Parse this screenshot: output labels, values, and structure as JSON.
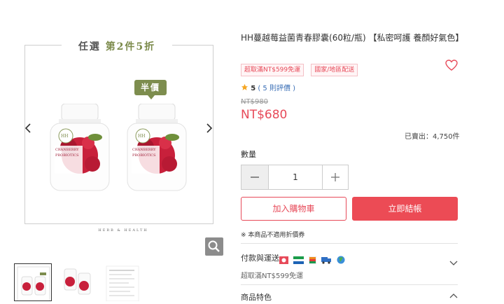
{
  "product": {
    "title": "HH蔓越莓益菌青春膠囊(60粒/瓶) 【私密呵護 養顏好氣色】",
    "tags": [
      "超取滿NT$599免運",
      "國家/地區配送"
    ],
    "rating": "5",
    "review_link": "( 5 則評價 )",
    "original_price": "NT$980",
    "price": "NT$680",
    "sold": "已賣出：4,750件",
    "quantity_label": "數量",
    "quantity": "1",
    "add_to_cart": "加入購物車",
    "buy_now": "立即結帳",
    "coupon_note": "※ 本商品不適用折價券",
    "accent_color": "#e74a59"
  },
  "gallery": {
    "promo_text_1": "任選",
    "promo_text_2": "第2件5折",
    "half_price_badge": "半價",
    "bottle_label_1": "CRANBERRY",
    "bottle_label_2": "PROBIOTICS",
    "bottle_logo": "HH",
    "brand_footer": "HERB & HEALTH",
    "thumbnail_count": 3
  },
  "sections": {
    "payment_title": "付款與運送",
    "payment_sub": "超取滿NT$599免運",
    "features_title": "商品特色"
  }
}
